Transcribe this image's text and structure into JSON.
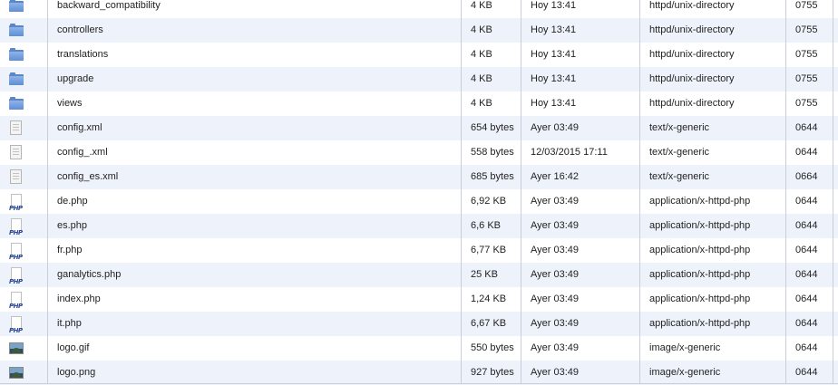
{
  "files": [
    {
      "icon": "folder-icon",
      "name": "backward_compatibility",
      "size": "4 KB",
      "date": "Hoy 13:41",
      "type": "httpd/unix-directory",
      "perms": "0755"
    },
    {
      "icon": "folder-icon",
      "name": "controllers",
      "size": "4 KB",
      "date": "Hoy 13:41",
      "type": "httpd/unix-directory",
      "perms": "0755"
    },
    {
      "icon": "folder-icon",
      "name": "translations",
      "size": "4 KB",
      "date": "Hoy 13:41",
      "type": "httpd/unix-directory",
      "perms": "0755"
    },
    {
      "icon": "folder-icon",
      "name": "upgrade",
      "size": "4 KB",
      "date": "Hoy 13:41",
      "type": "httpd/unix-directory",
      "perms": "0755"
    },
    {
      "icon": "folder-icon",
      "name": "views",
      "size": "4 KB",
      "date": "Hoy 13:41",
      "type": "httpd/unix-directory",
      "perms": "0755"
    },
    {
      "icon": "generic-file-icon",
      "name": "config.xml",
      "size": "654 bytes",
      "date": "Ayer 03:49",
      "type": "text/x-generic",
      "perms": "0644"
    },
    {
      "icon": "generic-file-icon",
      "name": "config_.xml",
      "size": "558 bytes",
      "date": "12/03/2015 17:11",
      "type": "text/x-generic",
      "perms": "0644"
    },
    {
      "icon": "generic-file-icon",
      "name": "config_es.xml",
      "size": "685 bytes",
      "date": "Ayer 16:42",
      "type": "text/x-generic",
      "perms": "0664"
    },
    {
      "icon": "php-file-icon",
      "name": "de.php",
      "size": "6,92 KB",
      "date": "Ayer 03:49",
      "type": "application/x-httpd-php",
      "perms": "0644"
    },
    {
      "icon": "php-file-icon",
      "name": "es.php",
      "size": "6,6 KB",
      "date": "Ayer 03:49",
      "type": "application/x-httpd-php",
      "perms": "0644"
    },
    {
      "icon": "php-file-icon",
      "name": "fr.php",
      "size": "6,77 KB",
      "date": "Ayer 03:49",
      "type": "application/x-httpd-php",
      "perms": "0644"
    },
    {
      "icon": "php-file-icon",
      "name": "ganalytics.php",
      "size": "25 KB",
      "date": "Ayer 03:49",
      "type": "application/x-httpd-php",
      "perms": "0644"
    },
    {
      "icon": "php-file-icon",
      "name": "index.php",
      "size": "1,24 KB",
      "date": "Ayer 03:49",
      "type": "application/x-httpd-php",
      "perms": "0644"
    },
    {
      "icon": "php-file-icon",
      "name": "it.php",
      "size": "6,67 KB",
      "date": "Ayer 03:49",
      "type": "application/x-httpd-php",
      "perms": "0644"
    },
    {
      "icon": "image-file-icon",
      "name": "logo.gif",
      "size": "550 bytes",
      "date": "Ayer 03:49",
      "type": "image/x-generic",
      "perms": "0644"
    },
    {
      "icon": "image-file-icon",
      "name": "logo.png",
      "size": "927 bytes",
      "date": "Ayer 03:49",
      "type": "image/x-generic",
      "perms": "0644"
    }
  ],
  "php_icon_text": "PHP",
  "colors": {
    "row_alt": "#eef3fb",
    "grid_line": "#c9cfd8",
    "folder": "#5b87c8"
  }
}
